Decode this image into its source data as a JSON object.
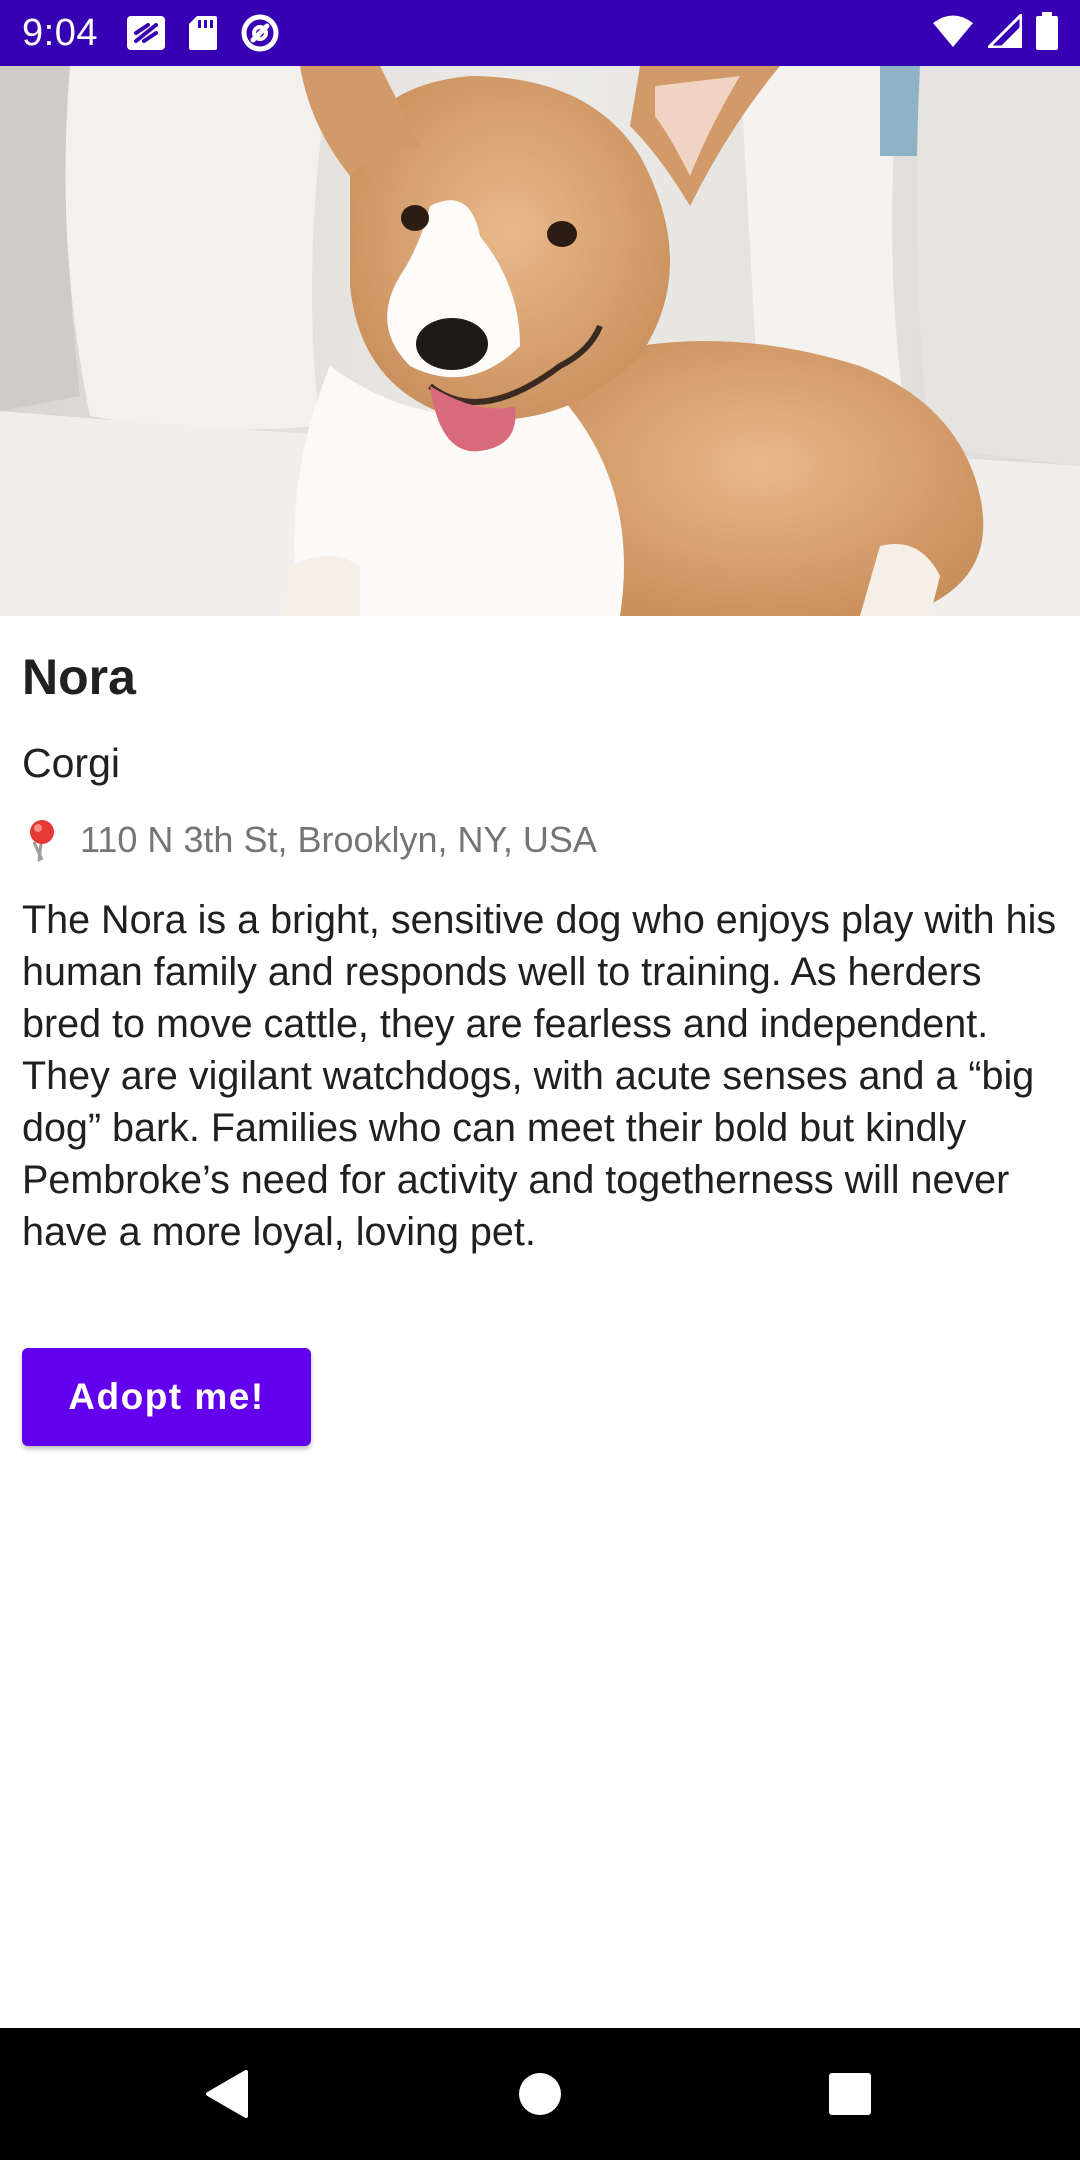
{
  "status_bar": {
    "time": "9:04",
    "background": "#3700b3",
    "left_icons": [
      "news-app-icon",
      "sd-card-icon",
      "at-sign-icon"
    ],
    "right_icons": [
      "wifi-icon",
      "cell-signal-icon",
      "battery-icon"
    ]
  },
  "pet": {
    "photo_subject": "corgi-photo",
    "name": "Nora",
    "breed": "Corgi",
    "location": "110 N 3th St, Brooklyn, NY, USA",
    "location_icon": "map-pin-icon",
    "description": "The Nora is a bright, sensitive dog who enjoys play with his human family and responds well to training. As herders bred to move cattle, they are fearless and independent. They are vigilant watchdogs, with acute senses and a “big dog” bark. Families who can meet their bold but kindly Pembroke’s need for activity and togetherness will never have a more loyal, loving pet."
  },
  "actions": {
    "adopt_label": "Adopt me!",
    "accent": "#6200ee"
  },
  "nav_bar": {
    "buttons": [
      "back-icon",
      "home-icon",
      "recents-icon"
    ]
  }
}
